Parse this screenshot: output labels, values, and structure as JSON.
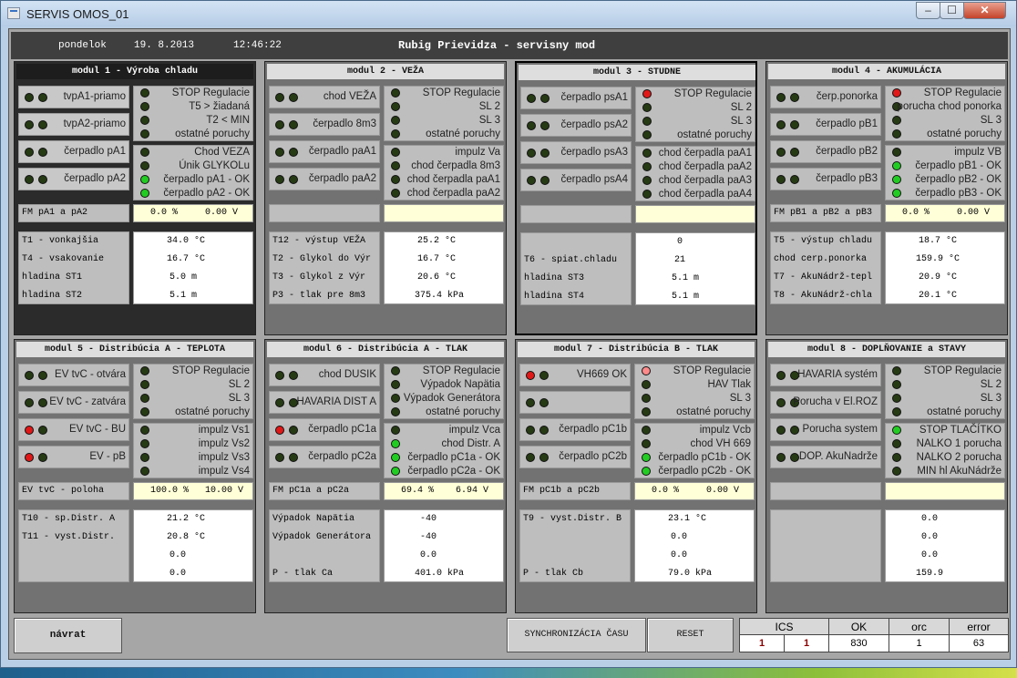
{
  "window": {
    "title": "SERVIS OMOS_01"
  },
  "header": {
    "day": "pondelok",
    "date": "19. 8.2013",
    "time": "12:46:22",
    "title": "Rubig Prievidza - servisny mod"
  },
  "modules": [
    {
      "title": "modul 1  -  Výroba chladu",
      "style": "dark",
      "rows": [
        {
          "label": "tvpA1-priamo",
          "leds": [
            "off",
            "off"
          ],
          "lines": [
            {
              "t": "STOP Regulacie",
              "c": "off"
            },
            {
              "t": "T5 > žiadaná",
              "c": "off"
            },
            {
              "t": "T2 < MIN",
              "c": "off"
            },
            {
              "t": "ostatné poruchy",
              "c": "off"
            }
          ]
        },
        {
          "label": "tvpA2-priamo",
          "leds": [
            "off",
            "off"
          ]
        },
        {
          "label": "čerpadlo pA1",
          "leds": [
            "off",
            "off"
          ],
          "lines": [
            {
              "t": "Chod VEZA",
              "c": "off"
            },
            {
              "t": "Únik GLYKOLu",
              "c": "off"
            },
            {
              "t": "čerpadlo pA1 - OK",
              "c": "grn"
            },
            {
              "t": "čerpadlo pA2 - OK",
              "c": "grn"
            }
          ]
        },
        {
          "label": "čerpadlo pA2",
          "leds": [
            "off",
            "off"
          ]
        }
      ],
      "fm": {
        "label": "FM pA1 a pA2",
        "v1": "0.0 %",
        "v2": "0.00 V"
      },
      "labels": [
        "T1 - vonkajšia",
        "T4 - vsakovanie",
        "hladina ST1",
        "hladina ST2"
      ],
      "values": [
        [
          "34.0",
          "°C"
        ],
        [
          "16.7",
          "°C"
        ],
        [
          "5.0",
          "m"
        ],
        [
          "5.1",
          "m"
        ]
      ]
    },
    {
      "title": "modul 2  -  VEŽA",
      "style": "",
      "rows": [
        {
          "label": "chod VEŽA",
          "leds": [
            "off",
            "off"
          ],
          "lines": [
            {
              "t": "STOP Regulacie",
              "c": "off"
            },
            {
              "t": "SL 2",
              "c": "off"
            },
            {
              "t": "SL 3",
              "c": "off"
            },
            {
              "t": "ostatné poruchy",
              "c": "off"
            }
          ]
        },
        {
          "label": "čerpadlo 8m3",
          "leds": [
            "off",
            "off"
          ]
        },
        {
          "label": "čerpadlo paA1",
          "leds": [
            "off",
            "off"
          ],
          "lines": [
            {
              "t": "impulz Va",
              "c": "off"
            },
            {
              "t": "chod čerpadla 8m3",
              "c": "off"
            },
            {
              "t": "chod čerpadla paA1",
              "c": "off"
            },
            {
              "t": "chod čerpadla paA2",
              "c": "off"
            }
          ]
        },
        {
          "label": "čerpadlo paA2",
          "leds": [
            "off",
            "off"
          ]
        }
      ],
      "fm": {
        "label": "",
        "v1": "",
        "v2": ""
      },
      "labels": [
        "T12 - výstup VEŽA",
        "T2 - Glykol do Výr",
        "T3 - Glykol z  Výr",
        "P3 - tlak pre 8m3"
      ],
      "values": [
        [
          "25.2",
          "°C"
        ],
        [
          "16.7",
          "°C"
        ],
        [
          "20.6",
          "°C"
        ],
        [
          "375.4",
          "kPa"
        ]
      ]
    },
    {
      "title": "modul 3  -  STUDNE",
      "style": "sel",
      "rows": [
        {
          "label": "čerpadlo psA1",
          "leds": [
            "off",
            "off"
          ],
          "lines": [
            {
              "t": "STOP Regulacie",
              "c": "red"
            },
            {
              "t": "SL 2",
              "c": "off"
            },
            {
              "t": "SL 3",
              "c": "off"
            },
            {
              "t": "ostatné poruchy",
              "c": "off"
            }
          ]
        },
        {
          "label": "čerpadlo psA2",
          "leds": [
            "off",
            "off"
          ]
        },
        {
          "label": "čerpadlo psA3",
          "leds": [
            "off",
            "off"
          ],
          "lines": [
            {
              "t": "chod čerpadla paA1",
              "c": "off"
            },
            {
              "t": "chod čerpadla paA2",
              "c": "off"
            },
            {
              "t": "chod čerpadla paA3",
              "c": "off"
            },
            {
              "t": "chod čerpadla paA4",
              "c": "off"
            }
          ]
        },
        {
          "label": "čerpadlo psA4",
          "leds": [
            "off",
            "off"
          ]
        }
      ],
      "fm": {
        "label": "",
        "v1": "",
        "v2": ""
      },
      "labels": [
        "",
        "T6 - spiat.chladu",
        "hladina ST3",
        "hladina ST4"
      ],
      "values": [
        [
          "0",
          ""
        ],
        [
          "21",
          ""
        ],
        [
          "5.1",
          "m"
        ],
        [
          "5.1",
          "m"
        ]
      ]
    },
    {
      "title": "modul 4  -  AKUMULÁCIA",
      "style": "",
      "rows": [
        {
          "label": "čerp.ponorka",
          "leds": [
            "off",
            "off"
          ],
          "lines": [
            {
              "t": "STOP Regulacie",
              "c": "red"
            },
            {
              "t": "porucha chod ponorka",
              "c": "off"
            },
            {
              "t": "SL 3",
              "c": "off"
            },
            {
              "t": "ostatné poruchy",
              "c": "off"
            }
          ]
        },
        {
          "label": "čerpadlo pB1",
          "leds": [
            "off",
            "off"
          ]
        },
        {
          "label": "čerpadlo pB2",
          "leds": [
            "off",
            "off"
          ],
          "lines": [
            {
              "t": "impulz VB",
              "c": "off"
            },
            {
              "t": "čerpadlo pB1 - OK",
              "c": "grn"
            },
            {
              "t": "čerpadlo pB2 - OK",
              "c": "grn"
            },
            {
              "t": "čerpadlo pB3 - OK",
              "c": "grn"
            }
          ]
        },
        {
          "label": "čerpadlo pB3",
          "leds": [
            "off",
            "off"
          ]
        }
      ],
      "fm": {
        "label": "FM pB1 a pB2 a pB3",
        "v1": "0.0 %",
        "v2": "0.00 V"
      },
      "labels": [
        "T5 - výstup chladu",
        "chod cerp.ponorka",
        "T7 - AkuNádrž-tepl",
        "T8 - AkuNádrž-chla"
      ],
      "values": [
        [
          "18.7",
          "°C"
        ],
        [
          "159.9",
          "°C"
        ],
        [
          "20.9",
          "°C"
        ],
        [
          "20.1",
          "°C"
        ]
      ]
    },
    {
      "title": "modul 5  -  Distribúcia A  -  TEPLOTA",
      "style": "",
      "rows": [
        {
          "label": "EV tvC - otvára",
          "leds": [
            "off",
            "off"
          ],
          "lines": [
            {
              "t": "STOP Regulacie",
              "c": "off"
            },
            {
              "t": "SL 2",
              "c": "off"
            },
            {
              "t": "SL 3",
              "c": "off"
            },
            {
              "t": "ostatné poruchy",
              "c": "off"
            }
          ]
        },
        {
          "label": "EV tvC - zatvára",
          "leds": [
            "off",
            "off"
          ]
        },
        {
          "label": "EV tvC - BU",
          "leds": [
            "red",
            "off"
          ],
          "lines": [
            {
              "t": "impulz Vs1",
              "c": "off"
            },
            {
              "t": "impulz Vs2",
              "c": "off"
            },
            {
              "t": "impulz Vs3",
              "c": "off"
            },
            {
              "t": "impulz Vs4",
              "c": "off"
            }
          ]
        },
        {
          "label": "EV - pB",
          "leds": [
            "red",
            "off"
          ]
        }
      ],
      "fm": {
        "label": "EV tvC - poloha",
        "v1": "100.0 %",
        "v2": "10.00 V"
      },
      "labels": [
        "T10 - sp.Distr. A",
        "T11 - vyst.Distr.",
        "",
        ""
      ],
      "values": [
        [
          "21.2",
          "°C"
        ],
        [
          "20.8",
          "°C"
        ],
        [
          "0.0",
          ""
        ],
        [
          "0.0",
          ""
        ]
      ]
    },
    {
      "title": "modul 6  -  Distribúcia A  -  TLAK",
      "style": "",
      "rows": [
        {
          "label": "chod  DUSIK",
          "leds": [
            "off",
            "off"
          ],
          "lines": [
            {
              "t": "STOP Regulacie",
              "c": "off"
            },
            {
              "t": "Výpadok Napätia",
              "c": "off"
            },
            {
              "t": "Výpadok Generátora",
              "c": "off"
            },
            {
              "t": "ostatné poruchy",
              "c": "off"
            }
          ]
        },
        {
          "label": "HAVARIA DIST A",
          "leds": [
            "off",
            "off"
          ]
        },
        {
          "label": "čerpadlo pC1a",
          "leds": [
            "red",
            "off"
          ],
          "lines": [
            {
              "t": "impulz Vca",
              "c": "off"
            },
            {
              "t": "chod Distr. A",
              "c": "grn"
            },
            {
              "t": "čerpadlo pC1a - OK",
              "c": "grn"
            },
            {
              "t": "čerpadlo pC2a - OK",
              "c": "grn"
            }
          ]
        },
        {
          "label": "čerpadlo pC2a",
          "leds": [
            "off",
            "off"
          ]
        }
      ],
      "fm": {
        "label": "FM pC1a a pC2a",
        "v1": "69.4 %",
        "v2": "6.94 V"
      },
      "labels": [
        "Výpadok Napätia",
        "Výpadok Generátora",
        "",
        "P - tlak Ca"
      ],
      "values": [
        [
          "-40",
          ""
        ],
        [
          "-40",
          ""
        ],
        [
          "0.0",
          ""
        ],
        [
          "401.0",
          "kPa"
        ]
      ]
    },
    {
      "title": "modul 7  -  Distribúcia B  -  TLAK",
      "style": "",
      "rows": [
        {
          "label": "VH669 OK",
          "leds": [
            "red",
            "off"
          ],
          "lines": [
            {
              "t": "STOP Regulacie",
              "c": "pink"
            },
            {
              "t": "HAV Tlak",
              "c": "off"
            },
            {
              "t": "SL 3",
              "c": "off"
            },
            {
              "t": "ostatné poruchy",
              "c": "off"
            }
          ]
        },
        {
          "label": "",
          "leds": [
            "off",
            "off"
          ]
        },
        {
          "label": "čerpadlo pC1b",
          "leds": [
            "off",
            "off"
          ],
          "lines": [
            {
              "t": "impulz Vcb",
              "c": "off"
            },
            {
              "t": "chod VH 669",
              "c": "off"
            },
            {
              "t": "čerpadlo pC1b - OK",
              "c": "grn"
            },
            {
              "t": "čerpadlo pC2b - OK",
              "c": "grn"
            }
          ]
        },
        {
          "label": "čerpadlo pC2b",
          "leds": [
            "off",
            "off"
          ]
        }
      ],
      "fm": {
        "label": "FM pC1b a pC2b",
        "v1": "0.0 %",
        "v2": "0.00 V"
      },
      "labels": [
        "T9 - vyst.Distr. B",
        "",
        "",
        "P - tlak Cb"
      ],
      "values": [
        [
          "23.1",
          "°C"
        ],
        [
          "0.0",
          ""
        ],
        [
          "0.0",
          ""
        ],
        [
          "79.0",
          "kPa"
        ]
      ]
    },
    {
      "title": "modul 8  -  DOPLŇOVANIE a STAVY",
      "style": "",
      "rows": [
        {
          "label": "HAVARIA systém",
          "leds": [
            "off",
            "off"
          ],
          "lines": [
            {
              "t": "STOP Regulacie",
              "c": "off"
            },
            {
              "t": "SL 2",
              "c": "off"
            },
            {
              "t": "SL 3",
              "c": "off"
            },
            {
              "t": "ostatné poruchy",
              "c": "off"
            }
          ]
        },
        {
          "label": "Porucha v El.ROZ",
          "leds": [
            "off",
            "off"
          ]
        },
        {
          "label": "Porucha system",
          "leds": [
            "off",
            "off"
          ],
          "lines": [
            {
              "t": "STOP TLAČÍTKO",
              "c": "grn"
            },
            {
              "t": "NALKO 1 porucha",
              "c": "off"
            },
            {
              "t": "NALKO 2 porucha",
              "c": "off"
            },
            {
              "t": "MIN hl AkuNádrže",
              "c": "off"
            }
          ]
        },
        {
          "label": "DOP. AkuNadrže",
          "leds": [
            "off",
            "off"
          ]
        }
      ],
      "fm": {
        "label": "",
        "v1": "",
        "v2": ""
      },
      "labels": [
        "",
        "",
        "",
        ""
      ],
      "values": [
        [
          "0.0",
          ""
        ],
        [
          "0.0",
          ""
        ],
        [
          "0.0",
          ""
        ],
        [
          "159.9",
          ""
        ]
      ]
    }
  ],
  "buttons": {
    "back": "návrat",
    "sync": "SYNCHRONIZÁCIA ČASU",
    "reset": "RESET"
  },
  "status": {
    "headers": [
      "ICS",
      "OK",
      "orc",
      "error"
    ],
    "values": [
      "1",
      "1",
      "830",
      "1",
      "63"
    ]
  },
  "colors": {
    "led_off": "#263a14",
    "led_red": "#e01818",
    "led_green": "#22cc22",
    "input_bg": "#ffffd8"
  }
}
